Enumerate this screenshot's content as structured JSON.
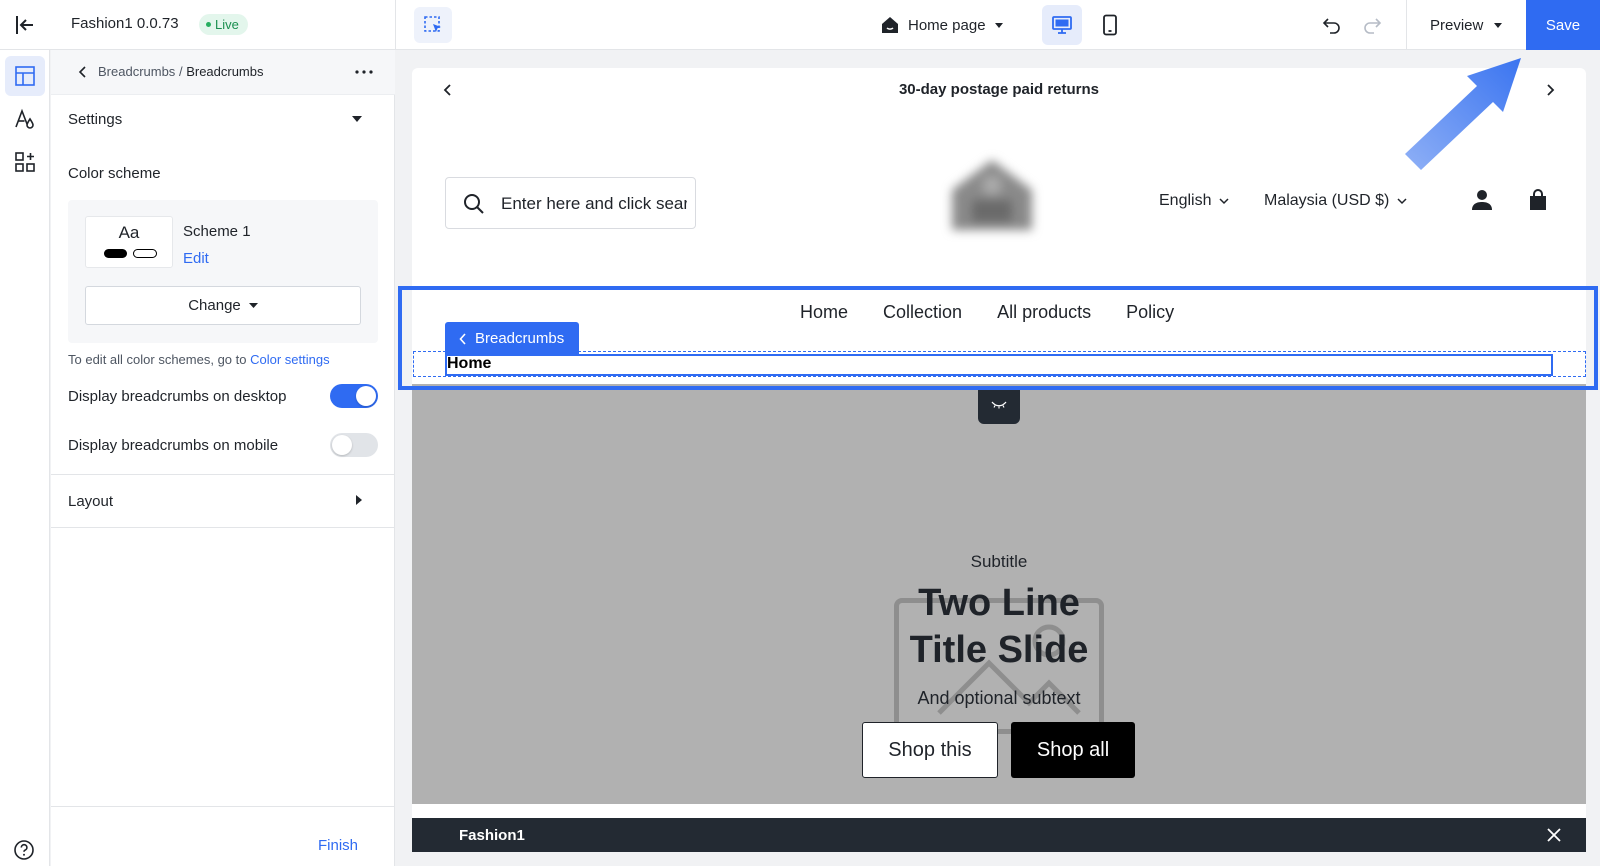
{
  "topbar": {
    "theme_name": "Fashion1 0.0.73",
    "live_label": "Live",
    "page_picker": "Home page",
    "preview_label": "Preview",
    "save_label": "Save"
  },
  "panel": {
    "breadcrumb_parent": "Breadcrumbs",
    "breadcrumb_separator": "/",
    "breadcrumb_current": "Breadcrumbs",
    "settings_title": "Settings",
    "color_scheme_label": "Color scheme",
    "swatch_text": "Aa",
    "scheme_name": "Scheme 1",
    "scheme_edit": "Edit",
    "change_label": "Change",
    "hint_text": "To edit all color schemes, go to",
    "hint_link": "Color settings",
    "desktop_toggle_label": "Display breadcrumbs on desktop",
    "desktop_toggle_on": true,
    "mobile_toggle_label": "Display breadcrumbs on mobile",
    "mobile_toggle_on": false,
    "layout_title": "Layout",
    "finish_label": "Finish"
  },
  "store": {
    "announcement": "30-day postage paid returns",
    "search_placeholder": "Enter here and click search",
    "language": "English",
    "region": "Malaysia (USD $)",
    "nav": [
      "Home",
      "Collection",
      "All products",
      "Policy"
    ],
    "section_tag": "Breadcrumbs",
    "breadcrumb_home": "Home",
    "hero": {
      "subtitle": "Subtitle",
      "title_line1": "Two Line",
      "title_line2": "Title Slide",
      "subtext": "And optional subtext",
      "button1": "Shop this",
      "button2": "Shop all"
    },
    "footer_bar_title": "Fashion1"
  },
  "colors": {
    "accent": "#2f6bf2",
    "live_bg": "#e3f6ec",
    "live_text": "#1a8f4f",
    "hero_bg": "#b1b1b1",
    "dark_bar": "#232a33"
  },
  "icons": {
    "rail": [
      "sections-icon",
      "theme-styles-icon",
      "apps-icon"
    ],
    "help": "help-icon"
  }
}
